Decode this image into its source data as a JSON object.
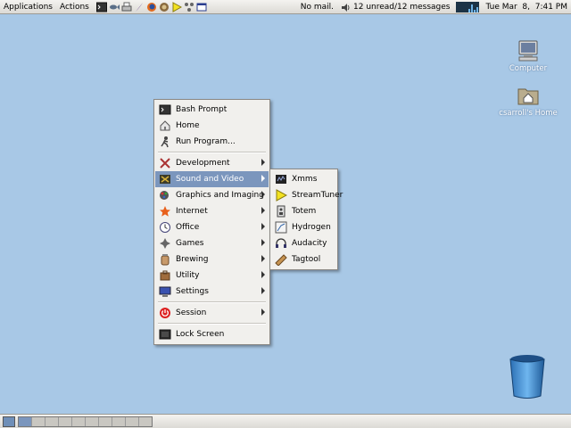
{
  "top_panel": {
    "applications_label": "Applications",
    "actions_label": "Actions",
    "launchers": [
      "terminal-icon",
      "fish-icon",
      "printer-icon",
      "feather-icon",
      "firefox-icon",
      "gimp-icon",
      "play-icon",
      "network-icon",
      "window-icon"
    ],
    "mail_status": "No mail.",
    "messages_status": "12 unread/12 messages",
    "clock": "Tue Mar  8,  7:41 PM"
  },
  "desktop_icons": [
    {
      "label": "Computer",
      "icon": "computer-icon"
    },
    {
      "label": "csarroll's Home",
      "icon": "home-folder-icon"
    },
    {
      "label": "",
      "icon": "trash-icon"
    }
  ],
  "main_menu": {
    "items": [
      {
        "label": "Bash Prompt",
        "icon": "terminal-icon"
      },
      {
        "label": "Home",
        "icon": "home-icon"
      },
      {
        "label": "Run Program...",
        "icon": "run-icon"
      },
      {
        "label": "Development",
        "icon": "tools-icon"
      },
      {
        "label": "Sound and Video",
        "icon": "film-icon"
      },
      {
        "label": "Graphics and Imaging",
        "icon": "paint-icon"
      },
      {
        "label": "Internet",
        "icon": "star-icon"
      },
      {
        "label": "Office",
        "icon": "clock-icon"
      },
      {
        "label": "Games",
        "icon": "gamepad-icon"
      },
      {
        "label": "Brewing",
        "icon": "jar-icon"
      },
      {
        "label": "Utility",
        "icon": "utility-icon"
      },
      {
        "label": "Settings",
        "icon": "monitor-icon"
      },
      {
        "label": "Session",
        "icon": "power-icon"
      },
      {
        "label": "Lock Screen",
        "icon": "lock-screen-icon"
      }
    ]
  },
  "sound_video_submenu": {
    "items": [
      {
        "label": "Xmms",
        "icon": "xmms-icon"
      },
      {
        "label": "StreamTuner",
        "icon": "play-icon"
      },
      {
        "label": "Totem",
        "icon": "totem-icon"
      },
      {
        "label": "Hydrogen",
        "icon": "hydrogen-icon"
      },
      {
        "label": "Audacity",
        "icon": "headphones-icon"
      },
      {
        "label": "Tagtool",
        "icon": "tag-icon"
      }
    ]
  },
  "colors": {
    "desktop": "#a8c8e6",
    "menu_highlight": "#7b96bd",
    "panel": "#dcdad5"
  }
}
